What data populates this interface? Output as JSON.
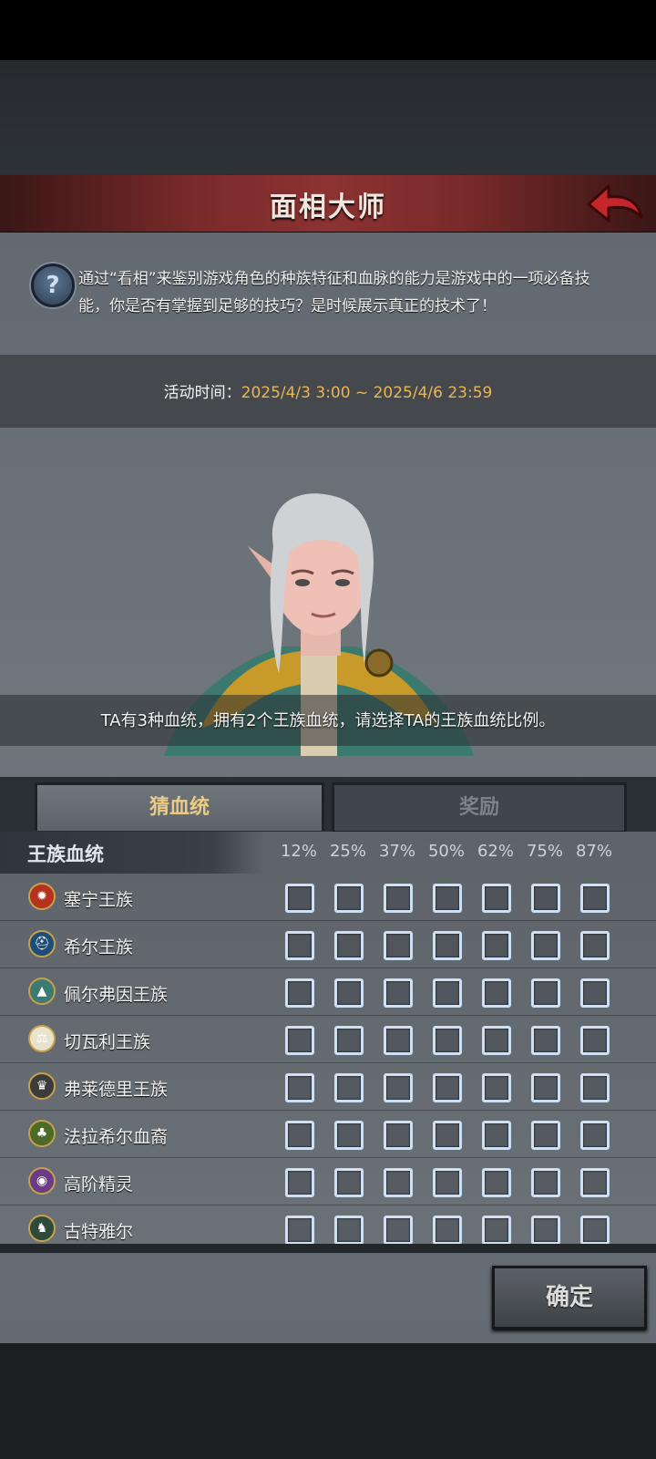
{
  "header": {
    "title": "面相大师"
  },
  "info": {
    "description": "通过“看相”来鉴别游戏角色的种族特征和血脉的能力是游戏中的一项必备技能，你是否有掌握到足够的技巧？是时候展示真正的技术了！",
    "time_label": "活动时间：",
    "time_value": "2025/4/3 3:00 ~ 2025/4/6 23:59"
  },
  "prompt": "TA有3种血统，拥有2个王族血统，请选择TA的王族血统比例。",
  "tabs": [
    {
      "label": "猜血统",
      "active": true
    },
    {
      "label": "奖励",
      "active": false
    }
  ],
  "table": {
    "header_label": "王族血统",
    "percentages": [
      "12%",
      "25%",
      "37%",
      "50%",
      "62%",
      "75%",
      "87%"
    ],
    "rows": [
      {
        "name": "塞宁王族",
        "icon": "sun-crest-icon",
        "color": "#b3331e"
      },
      {
        "name": "希尔王族",
        "icon": "helm-crest-icon",
        "color": "#1e4e78"
      },
      {
        "name": "佩尔弗因王族",
        "icon": "mountain-crest-icon",
        "color": "#3d7a73"
      },
      {
        "name": "切瓦利王族",
        "icon": "scales-crest-icon",
        "color": "#e9e2cc"
      },
      {
        "name": "弗莱德里王族",
        "icon": "lion-crest-icon",
        "color": "#3b3b3b"
      },
      {
        "name": "法拉希尔血裔",
        "icon": "tree-crest-icon",
        "color": "#4c6b27"
      },
      {
        "name": "高阶精灵",
        "icon": "eye-crest-icon",
        "color": "#6a3c87"
      },
      {
        "name": "古特雅尔",
        "icon": "beast-crest-icon",
        "color": "#2d4a3a"
      }
    ]
  },
  "confirm_label": "确定"
}
